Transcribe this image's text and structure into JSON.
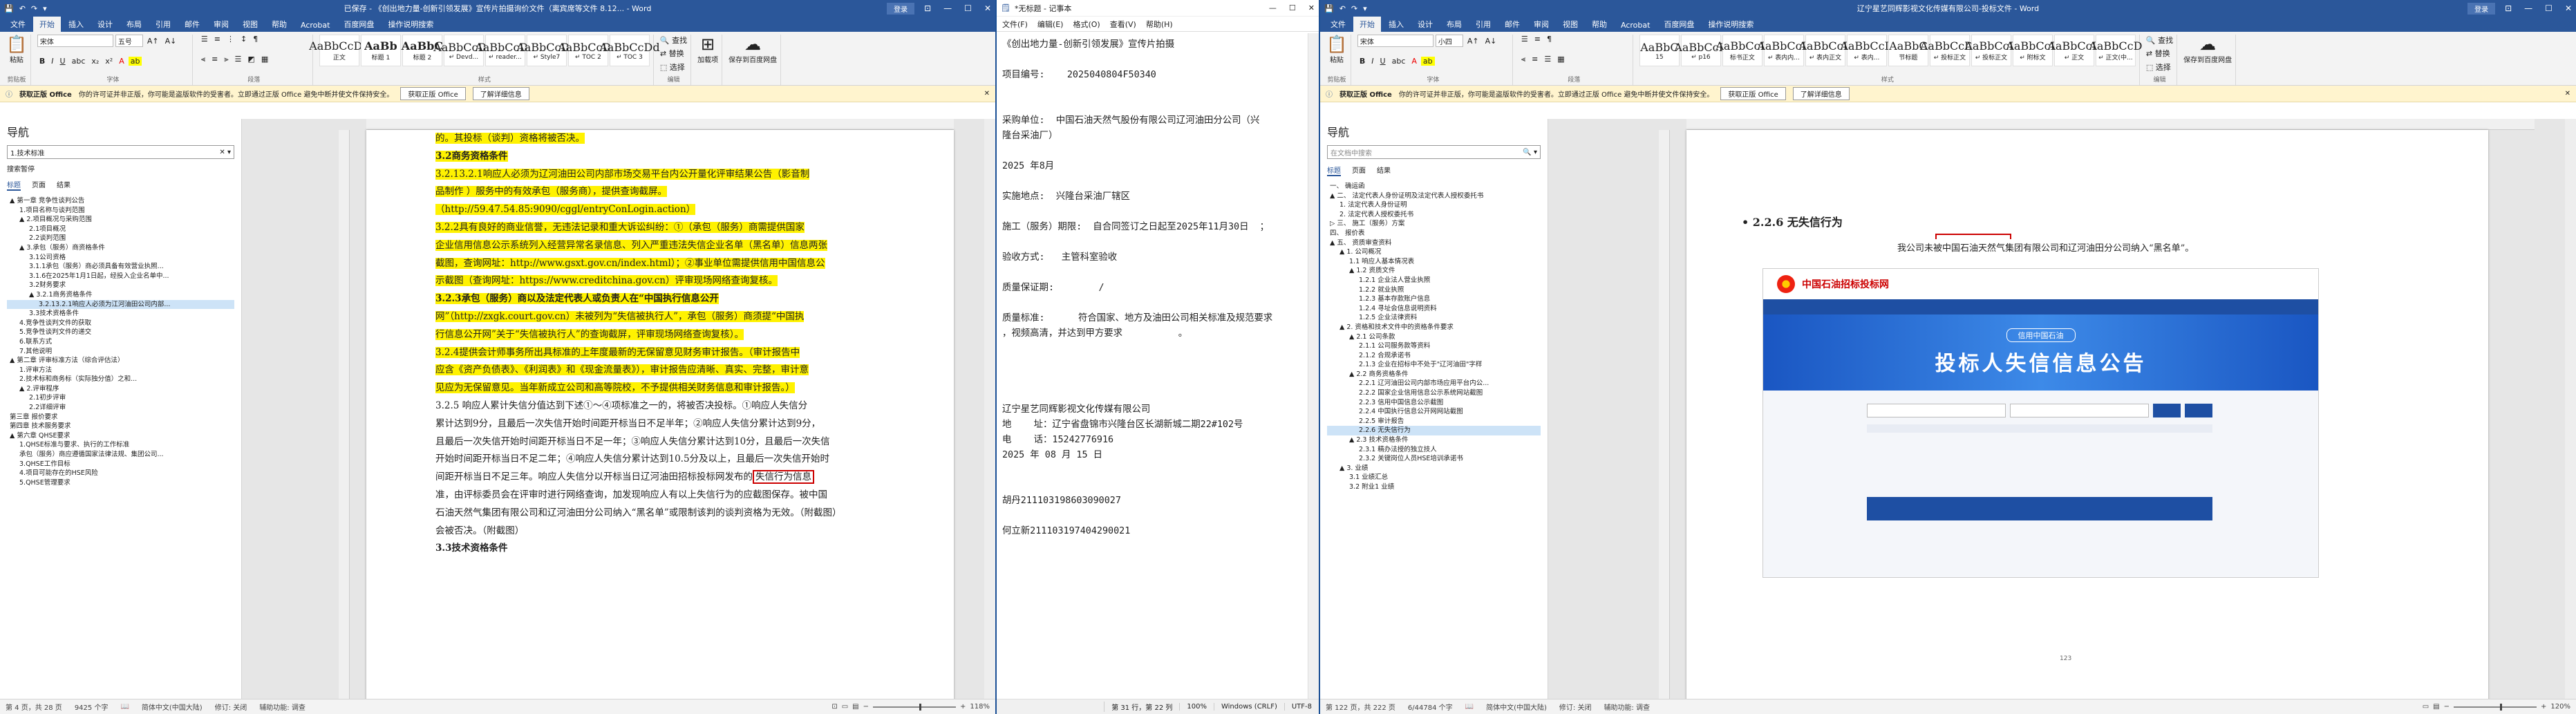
{
  "win1": {
    "title": "已保存 - 《创出地力量-创新引领发展》宣传片拍摄询价文件（离宾席等文件 8.12... - Word",
    "signin": "登录",
    "tabs": [
      "文件",
      "开始",
      "插入",
      "设计",
      "布局",
      "引用",
      "邮件",
      "审阅",
      "视图",
      "帮助",
      "Acrobat",
      "百度网盘",
      "操作说明搜索"
    ],
    "ribbon": {
      "paste": "粘贴",
      "font": "宋体",
      "size": "五号",
      "styles": [
        {
          "p": "AaBbCcDd",
          "n": "正文"
        },
        {
          "p": "AaBb",
          "n": "标题 1"
        },
        {
          "p": "AaBbC",
          "n": "标题 2"
        },
        {
          "p": "AaBbCcDd",
          "n": "↵ Devd..."
        },
        {
          "p": "AaBbCcDd",
          "n": "↵ reader..."
        },
        {
          "p": "AaBbCcDd",
          "n": "↵ Style7"
        },
        {
          "p": "AaBbCcDd",
          "n": "↵ TOC 2"
        },
        {
          "p": "AaBbCcDd",
          "n": "↵ TOC 3"
        }
      ],
      "find": "查找",
      "replace": "替换",
      "select": "选择",
      "edit": "编辑",
      "save": "保存到百度网盘",
      "pdf": "加载项",
      "g_clip": "剪贴板",
      "g_font": "字体",
      "g_para": "段落",
      "g_style": "样式"
    },
    "msg": {
      "label": "获取正版 Office",
      "text": "你的许可证并非正版，你可能是盗版软件的受害者。立即通过正版 Office 避免中断并使文件保持安全。",
      "btn1": "获取正版 Office",
      "btn2": "了解详细信息"
    },
    "nav": {
      "title": "导航",
      "search": "1.技术标准",
      "results": "搜索暂停",
      "tabs": [
        "标题",
        "页面",
        "结果"
      ],
      "items": [
        {
          "t": "▲ 第一章 竞争性谈判公告",
          "i": 0
        },
        {
          "t": "1.项目名称与谈判范围",
          "i": 1
        },
        {
          "t": "▲ 2.项目概况与采购范围",
          "i": 1
        },
        {
          "t": "2.1项目概况",
          "i": 2
        },
        {
          "t": "2.2谈判范围",
          "i": 2
        },
        {
          "t": "▲ 3.承包（服务）商资格条件",
          "i": 1
        },
        {
          "t": "3.1公司资格",
          "i": 2
        },
        {
          "t": "3.1.1承包（服务）商必须具备有效营业执照...",
          "i": 2
        },
        {
          "t": "3.1.6在2025年1月1日起，经投入企业名单中...",
          "i": 2
        },
        {
          "t": "3.2财务要求",
          "i": 2
        },
        {
          "t": "▲ 3.2.1商务资格条件",
          "i": 2
        },
        {
          "t": "3.2.13.2.1响应人必须为江河油田公司内部...",
          "i": 3,
          "sel": true
        },
        {
          "t": "3.3技术资格条件",
          "i": 2
        },
        {
          "t": "4.竞争性谈判文件的获取",
          "i": 1
        },
        {
          "t": "5.竞争性谈判文件的递交",
          "i": 1
        },
        {
          "t": "6.联系方式",
          "i": 1
        },
        {
          "t": "7.其他说明",
          "i": 1
        },
        {
          "t": "▲ 第二章 评审标准方法（综合评估法）",
          "i": 0
        },
        {
          "t": "1.评审方法",
          "i": 1
        },
        {
          "t": "2.技术标和商务标（实际独分值）之和...",
          "i": 1
        },
        {
          "t": "▲ 2.评审程序",
          "i": 1
        },
        {
          "t": "2.1初步评审",
          "i": 2
        },
        {
          "t": "2.2详细评审",
          "i": 2
        },
        {
          "t": "第三章 报价要求",
          "i": 0
        },
        {
          "t": "第四章 技术服务要求",
          "i": 0
        },
        {
          "t": "",
          "i": 0
        },
        {
          "t": "▲ 第六章 QHSE要求",
          "i": 0
        },
        {
          "t": "1.QHSE标准与要求、执行的工作标准",
          "i": 1
        },
        {
          "t": "承包（服务）商应遵循国家法律法规、集团公司...",
          "i": 1
        },
        {
          "t": "3.QHSE工作目标",
          "i": 1
        },
        {
          "t": "4.项目可能存在的HSE风险",
          "i": 1
        },
        {
          "t": "5.QHSE管理要求",
          "i": 1
        }
      ]
    },
    "doc": {
      "p1": "的。其投标（谈判）资格将被否决。",
      "h1": "3.2商务资格条件",
      "l1": "3.2.13.2.1响应人必须为辽河油田公司内部市场交易平台内公开量化评审结果公告（影音制",
      "l2": "品制作     ）服务中的有效承包（服务商），提供查询截屏。",
      "l3": "（http://59.47.54.85:9090/cggl/entryConLogin.action）",
      "l4": "3.2.2具有良好的商业信誉，无违法记录和重大诉讼纠纷：①（承包（服务）商需提供国家",
      "l5": "企业信用信息公示系统列入经营异常名录信息、列入严重违法失信企业名单（黑名单）信息两张",
      "l6": "截图，查询网址：http://www.gsxt.gov.cn/index.html）；②事业单位需提供信用中国信息公",
      "l7": "示截图（查询网址：https://www.creditchina.gov.cn）评审现场网络查询复核。",
      "l8": "3.2.3承包（服务）商以及法定代表人或负责人在“中国执行信息公开",
      "l9": "网”（http://zxgk.court.gov.cn）未被列为“失信被执行人”，承包（服务）商须提“中国执",
      "l10": "行信息公开网”关于“失信被执行人”的查询截屏，评审现场网络查询复核）。",
      "l11": "3.2.4提供会计师事务所出具标准的上年度最新的无保留意见财务审计报告。（审计报告中",
      "l12": "应含《资产负债表》、《利润表》和《现金流量表》），审计报告应清晰、真实、完整，审计意",
      "l13": "见应为无保留意见。当年新成立公司和高等院校，不予提供相关财务信息和审计报告。）",
      "l14": "3.2.5 响应人累计失信分值达到下述①～④项标准之一的，将被否决投标。①响应人失信分",
      "l15": "累计达到9分，且最后一次失信开始时间距开标当日不足半年；②响应人失信分累计达到9分，",
      "l16": "且最后一次失信开始时间距开标当日不足一年；③响应人失信分累计达到10分，且最后一次失信",
      "l17": "开始时间距开标当日不足二年；④响应人失信分累计达到10.5分及以上，且最后一次失信开始时",
      "l18": "间距开标当日不足三年。响应人失信分以开标当日辽河油田招标投标网发布的",
      "l18b": "失信行为信息",
      "l19": "准，由评标委员会在评审时进行网络查询，加发现响应人有以上失信行为的应截图保存。被中国",
      "l20": "石油天然气集团有限公司和辽河油田分公司纳入“黑名单”或限制该判的谈判资格为无效。（附截图）",
      "l21": "会被否决。（附截图）",
      "l22": "3.3技术资格条件"
    },
    "status": {
      "page": "第 4 页，共 28 页",
      "words": "9425 个字",
      "lang": "简体中文(中国大陆)",
      "track": "修订: 关闭",
      "access": "辅助功能: 调查",
      "zoom": "118%"
    }
  },
  "notepad": {
    "title": "*无标题 - 记事本",
    "menu": [
      "文件(F)",
      "编辑(E)",
      "格式(O)",
      "查看(V)",
      "帮助(H)"
    ],
    "lines": [
      "《创出地力量-创新引领发展》宣传片拍摄",
      "",
      "项目编号:    2025040804F50340",
      "",
      "",
      "采购单位:  中国石油天然气股份有限公司辽河油田分公司（兴",
      "隆台采油厂）",
      "",
      "2025 年8月",
      "",
      "实施地点:  兴隆台采油厂辖区",
      "",
      "施工（服务）期限:  自合同签订之日起至2025年11月30日  ；",
      "",
      "验收方式:   主管科室验收                                              ；",
      "",
      "质量保证期:        /                                              ；",
      "",
      "质量标准:      符合国家、地方及油田公司相关标准及规范要求",
      "，视频高清，并达到甲方要求          。",
      "",
      "",
      "",
      "",
      "辽宁星艺同辉影视文化传媒有限公司",
      "地    址：辽宁省盘锦市兴隆台区长湖新城二期22#102号",
      "电    话：15242776916",
      "2025 年 08 月 15 日",
      "",
      "",
      "胡丹211103198603090027",
      "",
      "何立新211103197404290021"
    ],
    "status": {
      "pos": "第 31 行，第 22 列",
      "zoom": "100%",
      "eol": "Windows (CRLF)",
      "enc": "UTF-8"
    }
  },
  "win2": {
    "title": "辽宁星艺同辉影视文化传媒有限公司-投标文件 - Word",
    "signin": "登录",
    "tabs": [
      "文件",
      "开始",
      "插入",
      "设计",
      "布局",
      "引用",
      "邮件",
      "审阅",
      "视图",
      "帮助",
      "Acrobat",
      "百度网盘",
      "操作说明搜索"
    ],
    "ribbon": {
      "font": "宋体",
      "size": "小四",
      "styles": [
        {
          "p": "AaBbC",
          "n": "15"
        },
        {
          "p": "AaBbCcD",
          "n": "↵ p16"
        },
        {
          "p": "AaBbCcD",
          "n": "标书正文"
        },
        {
          "p": "AaBbCcD",
          "n": "↵ 表内内..."
        },
        {
          "p": "AaBbCcD",
          "n": "↵ 表内正文"
        },
        {
          "p": "AaBbCcD",
          "n": "↵ 表内..."
        },
        {
          "p": "AaBbC",
          "n": "节标题"
        },
        {
          "p": "AaBbCcDc",
          "n": "↵ 投标正文"
        },
        {
          "p": "AaBbCcD",
          "n": "↵ 投标正文"
        },
        {
          "p": "AaBbCcD",
          "n": "↵ 附标文"
        },
        {
          "p": "AaBbCcD",
          "n": "↵ 正文"
        },
        {
          "p": "AaBbCcD",
          "n": "↵ 正文(中..."
        }
      ]
    },
    "msg": {
      "label": "获取正版 Office",
      "text": "你的许可证并非正版，你可能是盗版软件的受害者。立即通过正版 Office 避免中断并使文件保持安全。",
      "btn1": "获取正版 Office",
      "btn2": "了解详细信息"
    },
    "nav": {
      "title": "导航",
      "search": "在文档中搜索",
      "tabs": [
        "标题",
        "页面",
        "结果"
      ],
      "items": [
        {
          "t": "一、 确运函",
          "i": 0
        },
        {
          "t": "▲ 二、 法定代表人身份证明及法定代表人授权委托书",
          "i": 0
        },
        {
          "t": "1. 法定代表人身份证明",
          "i": 1
        },
        {
          "t": "2. 法定代表人授权委托书",
          "i": 1
        },
        {
          "t": "▷ 三、 施工（服务）方案",
          "i": 0
        },
        {
          "t": "四、 报价表",
          "i": 0
        },
        {
          "t": "▲ 五、 资质审查资料",
          "i": 0
        },
        {
          "t": "▲ 1. 公司概况",
          "i": 1
        },
        {
          "t": "1.1 响应人基本情况表",
          "i": 2
        },
        {
          "t": "▲ 1.2 资质文件",
          "i": 2
        },
        {
          "t": "1.2.1 企业法人营业执照",
          "i": 3
        },
        {
          "t": "1.2.2 就业执照",
          "i": 3
        },
        {
          "t": "1.2.3 基本存款账户信息",
          "i": 3
        },
        {
          "t": "1.2.4 寻址会信息说明资料",
          "i": 3
        },
        {
          "t": "1.2.5 企业法律资料",
          "i": 3
        },
        {
          "t": "▲ 2. 资格和技术文件中的资格条件要求",
          "i": 1
        },
        {
          "t": "▲ 2.1 公司条款",
          "i": 2
        },
        {
          "t": "2.1.1 公司服务款等资料",
          "i": 3
        },
        {
          "t": "2.1.2 合规承诺书",
          "i": 3
        },
        {
          "t": "2.1.3 企业在招标中不处于\"辽河油田\"字样",
          "i": 3
        },
        {
          "t": "▲ 2.2 商务资格条件",
          "i": 2
        },
        {
          "t": "2.2.1 辽河油田公司内部市场应用平台内公...",
          "i": 3
        },
        {
          "t": "2.2.2 国家企业信用信息公示系统网站截图",
          "i": 3
        },
        {
          "t": "2.2.3 信用中国信息公示截图",
          "i": 3
        },
        {
          "t": "2.2.4 中国执行信息公开网网站截图",
          "i": 3
        },
        {
          "t": "2.2.5 审计报告",
          "i": 3
        },
        {
          "t": "2.2.6 无失信行为",
          "i": 3,
          "sel": true
        },
        {
          "t": "▲ 2.3 技术资格条件",
          "i": 2
        },
        {
          "t": "2.3.1 精办法授的独立技人",
          "i": 3
        },
        {
          "t": "2.3.2 关键岗位人员HSE培训承诺书",
          "i": 3
        },
        {
          "t": "▲ 3. 业绩",
          "i": 1
        },
        {
          "t": "3.1 业绩汇总",
          "i": 2
        },
        {
          "t": "3.2 附业1 业绩",
          "i": 2
        }
      ]
    },
    "doc": {
      "heading": "2.2.6 无失信行为",
      "stmt": "我公司未被中国石油天然气集团有限公司和辽河油田分公司纳入“黑名单”。",
      "logo": "中国石油招标投标网",
      "banner": "投标人失信信息公告",
      "bannersub": "信用中国石油",
      "pagenum": "123"
    },
    "status": {
      "page": "第 122 页，共 222 页",
      "words": "6/44784 个字",
      "lang": "简体中文(中国大陆)",
      "track": "修订: 关闭",
      "access": "辅助功能: 调查",
      "zoom": "120%"
    }
  },
  "colors": {
    "word_blue": "#2b579a",
    "highlight": "#fff200",
    "redbox": "#cc0000"
  }
}
